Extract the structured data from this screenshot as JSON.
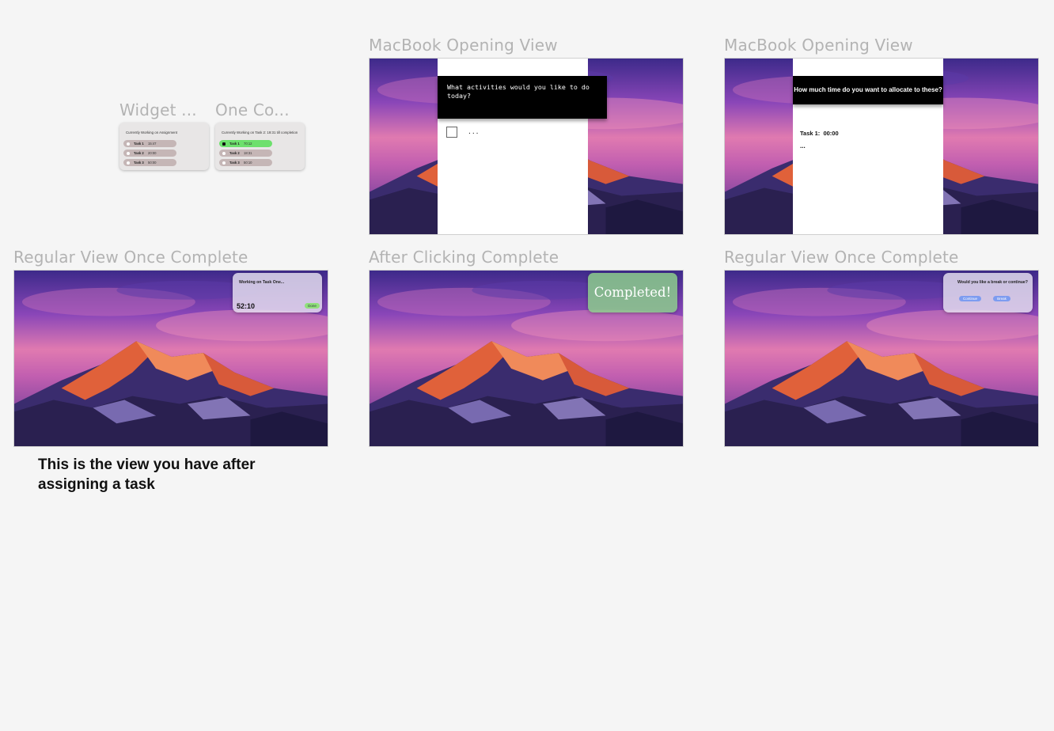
{
  "labels": {
    "widget": "Widget ...",
    "one_co": "One Co...",
    "macbook_1": "MacBook Opening View",
    "macbook_2": "MacBook Opening View",
    "regular_1": "Regular View Once Complete",
    "after_click": "After Clicking Complete",
    "regular_2": "Regular View Once Complete"
  },
  "widget_1": {
    "title": "Currently Working on Assignment",
    "tasks": [
      {
        "name": "Task 1",
        "time": "15:47"
      },
      {
        "name": "Task 2",
        "time": "20:00"
      },
      {
        "name": "Task 3",
        "time": "50:00"
      }
    ]
  },
  "widget_2": {
    "title": "Currently Working on Task 2: 19:31 till completion",
    "tasks": [
      {
        "name": "Task 1",
        "time": "70:12"
      },
      {
        "name": "Task 2",
        "time": "18:31"
      },
      {
        "name": "Task 3",
        "time": "50:10"
      }
    ]
  },
  "macbook_1": {
    "question": "What activities would you like to do today?",
    "placeholder": "..."
  },
  "macbook_2": {
    "question": "How much time do you want to allocate to these?",
    "task_line": "Task 1:  00:00",
    "more": "..."
  },
  "regular_1": {
    "card_title": "Working on Task One...",
    "timer": "52:10",
    "done_button": "Done"
  },
  "after_click": {
    "message": "Completed!"
  },
  "regular_2": {
    "card_title": "Would you like a break or continue?",
    "continue_button": "Continue",
    "break_button": "Break"
  },
  "note": "This is the view you have after assigning a task",
  "colors": {
    "canvas": "#f5f5f5",
    "label": "#b3b3b3",
    "active_task": "#6de06d",
    "task_row": "#c5b6b6",
    "pill_blue": "#7d9cf0",
    "done_green": "#8fe07a"
  }
}
